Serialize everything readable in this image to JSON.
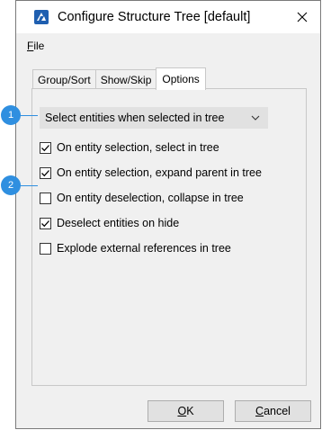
{
  "window": {
    "title": "Configure Structure Tree [default]",
    "app_icon": "bricscad-logo-icon",
    "close_icon": "close-icon"
  },
  "menu": {
    "file_prefix": "F",
    "file_rest": "ile"
  },
  "tabs": [
    {
      "label": "Group/Sort",
      "active": false
    },
    {
      "label": "Show/Skip",
      "active": false
    },
    {
      "label": "Options",
      "active": true
    }
  ],
  "options": {
    "dropdown_value": "Select entities when selected in tree",
    "checkboxes": [
      {
        "label": "On entity selection, select in tree",
        "checked": true
      },
      {
        "label": "On entity selection, expand parent in tree",
        "checked": true
      },
      {
        "label": "On entity deselection, collapse in tree",
        "checked": false
      },
      {
        "label": "Deselect entities on hide",
        "checked": true
      },
      {
        "label": "Explode external references in tree",
        "checked": false
      }
    ]
  },
  "buttons": {
    "ok_prefix": "O",
    "ok_rest": "K",
    "cancel_prefix": "C",
    "cancel_rest": "ancel"
  },
  "callouts": [
    "1",
    "2"
  ],
  "colors": {
    "accent": "#2f8fe0",
    "app_icon_bg": "#1f5fb0"
  }
}
